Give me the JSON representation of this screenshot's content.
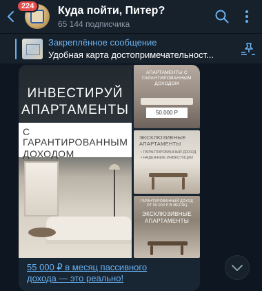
{
  "header": {
    "back_icon": "arrow-left-icon",
    "badge_count": "224",
    "title": "Куда пойти, Питер?",
    "subscribers": "65 144 подписчика",
    "search_icon": "search-icon",
    "menu_icon": "more-vertical-icon"
  },
  "pinned": {
    "title": "Закреплённое сообщение",
    "text": "Удобная карта достопримечательност...",
    "list_icon": "pin-list-icon"
  },
  "message": {
    "main_headline_line1": "ИНВЕСТИРУЙ",
    "main_headline_line2": "АПАРТАМЕНТЫ",
    "main_subline_line1": "С ГАРАНТИРОВАННЫМ",
    "main_subline_line2": "ДОХОДОМ",
    "tile1_line1": "АПАРТАМЕНТЫ С",
    "tile1_line2": "ГАРАНТИРОВАННЫМ",
    "tile1_line3": "ДОХОДОМ",
    "tile1_price": "50.000 Р",
    "tile2_line1": "ЭКСКЛЮЗИВНЫЕ",
    "tile2_line2": "АПАРТАМЕНТЫ",
    "tile2_item1": "• ГАРАНТИРОВАННЫЙ ДОХОД",
    "tile2_item2": "• НАДЕЖНЫЕ ИНВЕСТИЦИИ",
    "tile3_small1": "ГАРАНТИРОВАННЫЙ ДОХОД",
    "tile3_small2": "ОТ 50.000 Р В МЕСЯЦ",
    "tile3_line1": "ЭКСКЛЮЗИВНЫЕ",
    "tile3_line2": "АПАРТАМЕНТЫ",
    "link_line1": "55 000 ₽ в месяц пассивного",
    "link_line2": "дохода — это реально!"
  },
  "scroll_down_icon": "chevron-down-icon",
  "colors": {
    "background": "#0e1621",
    "header": "#17212b",
    "accent": "#6ab2f2",
    "badge": "#e44b4b",
    "bubble": "#182533"
  }
}
